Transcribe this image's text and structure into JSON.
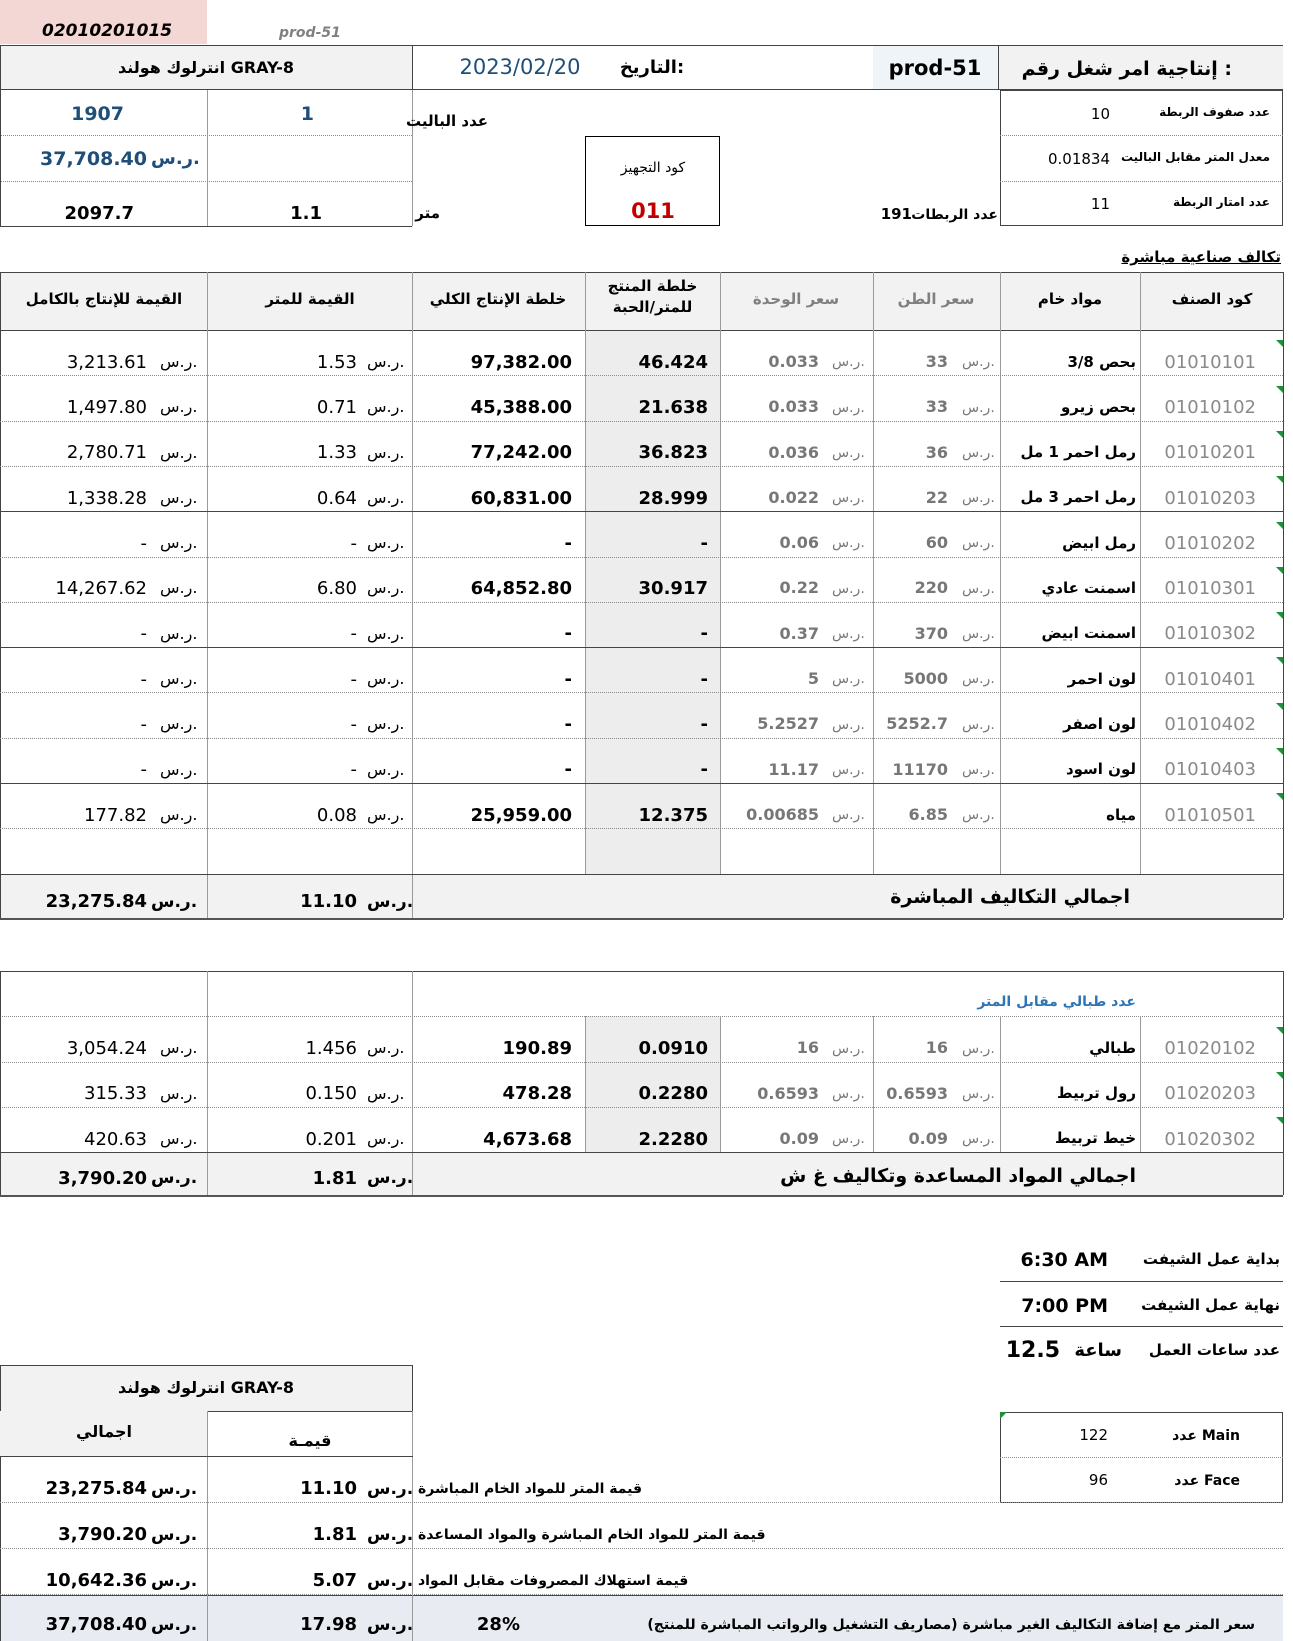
{
  "header": {
    "order_code": "02010201015",
    "prod_label_small": "prod-51",
    "product_name": "انترلوك هولند GRAY-8",
    "date_value": "2023/02/20",
    "date_label": "التاريخ:",
    "prod_number": "prod-51",
    "order_title": "إنتاجية امر شغل رقم :"
  },
  "info": {
    "pallets_total": "1907",
    "pallets_count": "1",
    "pallets_label": "عدد الباليت",
    "total_value": "37,708.40",
    "currency": "ر.س.",
    "meters_total": "2097.7",
    "meters_factor": "1.1",
    "meter_label": "متر",
    "setup_code_label": "كود التجهيز",
    "setup_code": "011",
    "bundles_count": "191",
    "bundles_label": "عدد الربطات",
    "right_box": [
      {
        "label": "عدد صفوف الربطة",
        "value": "10"
      },
      {
        "label": "معدل المتر مقابل الباليت",
        "value": "0.01834"
      },
      {
        "label": "عدد امتار الربطة",
        "value": "11"
      }
    ]
  },
  "direct_costs_title": "تكالف صناعية مباشرة",
  "table_headers": {
    "code": "كود الصنف",
    "material": "مواد خام",
    "ton_price": "سعر الطن",
    "unit_price": "سعر الوحدة",
    "mix_per": "خلطة المنتج للمتر/الحبة",
    "mix_total": "خلطة الإنتاج الكلي",
    "value_per": "القيمة للمتر",
    "value_total": "القيمة للإنتاج بالكامل"
  },
  "materials": [
    {
      "code": "01010101",
      "name": "بحص 3/8",
      "ton": "33",
      "unit": "0.033",
      "mix": "46.424",
      "mix_total": "97,382.00",
      "per_m": "1.53",
      "total": "3,213.61"
    },
    {
      "code": "01010102",
      "name": "بحص زيرو",
      "ton": "33",
      "unit": "0.033",
      "mix": "21.638",
      "mix_total": "45,388.00",
      "per_m": "0.71",
      "total": "1,497.80"
    },
    {
      "code": "01010201",
      "name": "رمل احمر 1 مل",
      "ton": "36",
      "unit": "0.036",
      "mix": "36.823",
      "mix_total": "77,242.00",
      "per_m": "1.33",
      "total": "2,780.71"
    },
    {
      "code": "01010203",
      "name": "رمل احمر 3 مل",
      "ton": "22",
      "unit": "0.022",
      "mix": "28.999",
      "mix_total": "60,831.00",
      "per_m": "0.64",
      "total": "1,338.28"
    },
    {
      "code": "01010202",
      "name": "رمل ابيض",
      "ton": "60",
      "unit": "0.06",
      "mix": "-",
      "mix_total": "-",
      "per_m": "-",
      "total": "-"
    },
    {
      "code": "01010301",
      "name": "اسمنت عادي",
      "ton": "220",
      "unit": "0.22",
      "mix": "30.917",
      "mix_total": "64,852.80",
      "per_m": "6.80",
      "total": "14,267.62"
    },
    {
      "code": "01010302",
      "name": "اسمنت ابيض",
      "ton": "370",
      "unit": "0.37",
      "mix": "-",
      "mix_total": "-",
      "per_m": "-",
      "total": "-"
    },
    {
      "code": "01010401",
      "name": "لون احمر",
      "ton": "5000",
      "unit": "5",
      "mix": "-",
      "mix_total": "-",
      "per_m": "-",
      "total": "-"
    },
    {
      "code": "01010402",
      "name": "لون اصفر",
      "ton": "5252.7",
      "unit": "5.2527",
      "mix": "-",
      "mix_total": "-",
      "per_m": "-",
      "total": "-"
    },
    {
      "code": "01010403",
      "name": "لون اسود",
      "ton": "11170",
      "unit": "11.17",
      "mix": "-",
      "mix_total": "-",
      "per_m": "-",
      "total": "-"
    },
    {
      "code": "01010501",
      "name": "مياه",
      "ton": "6.85",
      "unit": "0.00685",
      "mix": "12.375",
      "mix_total": "25,959.00",
      "per_m": "0.08",
      "total": "177.82"
    }
  ],
  "direct_total": {
    "label": "اجمالي التكاليف المباشرة",
    "per_m": "11.10",
    "total": "23,275.84"
  },
  "aux_title": "عدد طبالي مقابل المتر",
  "aux": [
    {
      "code": "01020102",
      "name": "طبالي",
      "ton": "16",
      "unit": "16",
      "mix": "0.0910",
      "mix_total": "190.89",
      "per_m": "1.456",
      "total": "3,054.24"
    },
    {
      "code": "01020203",
      "name": "رول تربيط",
      "ton": "0.6593",
      "unit": "0.6593",
      "mix": "0.2280",
      "mix_total": "478.28",
      "per_m": "0.150",
      "total": "315.33"
    },
    {
      "code": "01020302",
      "name": "خيط تربيط",
      "ton": "0.09",
      "unit": "0.09",
      "mix": "2.2280",
      "mix_total": "4,673.68",
      "per_m": "0.201",
      "total": "420.63"
    }
  ],
  "aux_total": {
    "label": "اجمالي المواد المساعدة وتكاليف غ ش",
    "per_m": "1.81",
    "total": "3,790.20"
  },
  "shift": {
    "start_label": "بداية عمل الشيفت",
    "start": "6:30 AM",
    "end_label": "نهاية عمل الشيفت",
    "end": "7:00 PM",
    "hours_label": "عدد ساعات العمل",
    "hours_unit": "ساعة",
    "hours": "12.5"
  },
  "counts": [
    {
      "label": "عدد Main",
      "value": "122"
    },
    {
      "label": "عدد Face",
      "value": "96"
    }
  ],
  "summary": {
    "product": "انترلوك هولند GRAY-8",
    "col_total": "اجمالي",
    "col_value": "قيمـة",
    "rows": [
      {
        "label": "قيمة المتر للمواد الخام المباشرة",
        "value": "11.10",
        "total": "23,275.84"
      },
      {
        "label": "قيمة المتر للمواد الخام المباشرة والمواد المساعدة",
        "value": "1.81",
        "total": "3,790.20"
      },
      {
        "label": "قيمة استهلاك المصروفات مقابل المواد",
        "value": "5.07",
        "total": "10,642.36"
      }
    ],
    "final": {
      "label": "سعر المتر مع إضافة التكاليف الغير مباشرة (مصاريف التشغيل والرواتب المباشرة للمنتج)",
      "percent": "28%",
      "value": "17.98",
      "total": "37,708.40"
    }
  },
  "colors": {
    "accent_red": "#c00000",
    "light_red": "#f2d7d5",
    "header_gray": "#f2f2f2",
    "mix_col_gray": "#ededed",
    "final_row": "#e8ecf2",
    "blue_text": "#1f4e79",
    "aux_blue": "#2e75b6"
  }
}
